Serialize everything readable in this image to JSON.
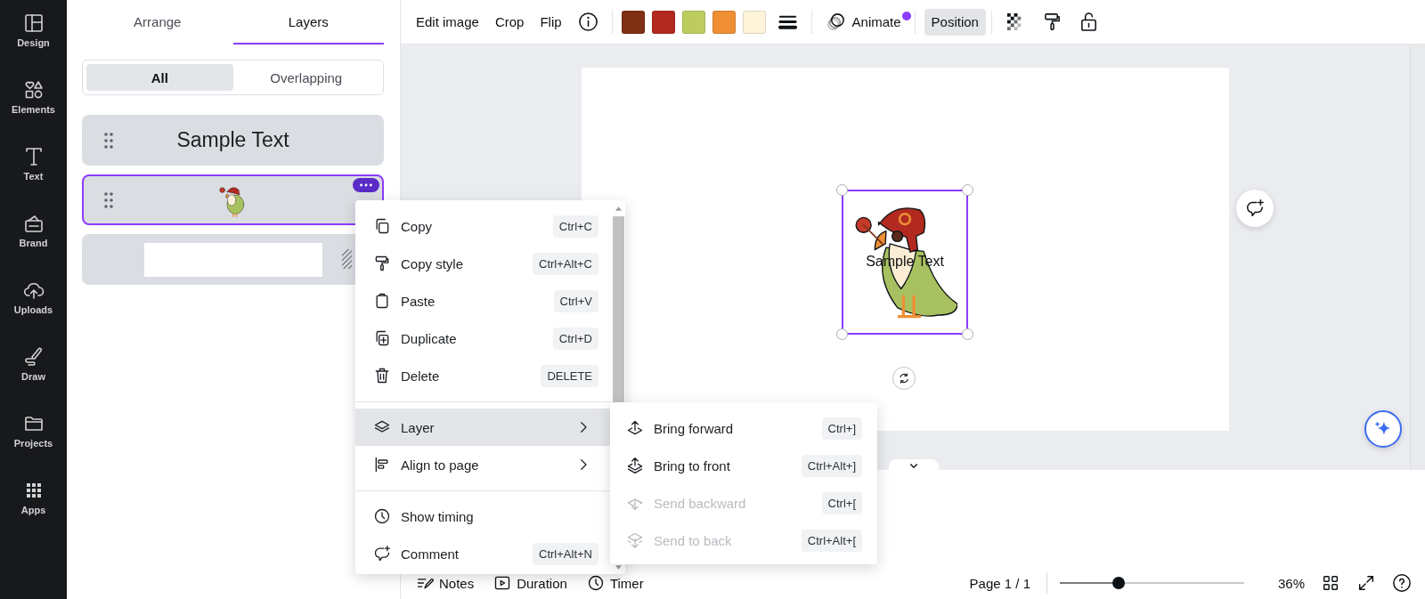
{
  "rail": [
    {
      "label": "Design"
    },
    {
      "label": "Elements"
    },
    {
      "label": "Text"
    },
    {
      "label": "Brand"
    },
    {
      "label": "Uploads"
    },
    {
      "label": "Draw"
    },
    {
      "label": "Projects"
    },
    {
      "label": "Apps"
    }
  ],
  "panel": {
    "tabs": [
      {
        "label": "Arrange",
        "selected": false
      },
      {
        "label": "Layers",
        "selected": true
      }
    ],
    "filters": [
      {
        "label": "All",
        "selected": true
      },
      {
        "label": "Overlapping",
        "selected": false
      }
    ],
    "layers": [
      {
        "kind": "text",
        "text": "Sample Text",
        "selected": false
      },
      {
        "kind": "image",
        "selected": true
      },
      {
        "kind": "shape",
        "selected": false
      }
    ]
  },
  "toolbar": {
    "actions": [
      {
        "label": "Edit image"
      },
      {
        "label": "Crop"
      },
      {
        "label": "Flip"
      }
    ],
    "swatches": [
      {
        "color": "#7f2f14"
      },
      {
        "color": "#b2291f"
      },
      {
        "color": "#bccc5e"
      },
      {
        "color": "#ee8f34"
      },
      {
        "color": "#fdf4da"
      }
    ],
    "animate": {
      "label": "Animate"
    },
    "position": {
      "label": "Position",
      "selected": true
    }
  },
  "canvas": {
    "text": "Sample Text"
  },
  "context_menu": {
    "groups": [
      {
        "items": [
          {
            "label": "Copy",
            "shortcut": "Ctrl+C",
            "selected": false,
            "submenu": false
          },
          {
            "label": "Copy style",
            "shortcut": "Ctrl+Alt+C",
            "selected": false,
            "submenu": false
          },
          {
            "label": "Paste",
            "shortcut": "Ctrl+V",
            "selected": false,
            "submenu": false
          },
          {
            "label": "Duplicate",
            "shortcut": "Ctrl+D",
            "selected": false,
            "submenu": false
          },
          {
            "label": "Delete",
            "shortcut": "DELETE",
            "selected": false,
            "submenu": false
          }
        ]
      },
      {
        "items": [
          {
            "label": "Layer",
            "selected": true,
            "submenu": true
          },
          {
            "label": "Align to page",
            "selected": false,
            "submenu": true
          }
        ]
      },
      {
        "items": [
          {
            "label": "Show timing",
            "selected": false,
            "submenu": false
          },
          {
            "label": "Comment",
            "shortcut": "Ctrl+Alt+N",
            "selected": false,
            "submenu": false
          }
        ]
      }
    ]
  },
  "submenu": {
    "items": [
      {
        "label": "Bring forward",
        "shortcut": "Ctrl+]",
        "disabled": false
      },
      {
        "label": "Bring to front",
        "shortcut": "Ctrl+Alt+]",
        "disabled": false
      },
      {
        "label": "Send backward",
        "shortcut": "Ctrl+[",
        "disabled": true
      },
      {
        "label": "Send to back",
        "shortcut": "Ctrl+Alt+[",
        "disabled": true
      }
    ]
  },
  "footer": {
    "tools": [
      {
        "label": "Notes"
      },
      {
        "label": "Duration"
      },
      {
        "label": "Timer"
      }
    ],
    "page": "Page 1 / 1",
    "zoom": {
      "level": 0.32,
      "reading": "36%"
    }
  }
}
